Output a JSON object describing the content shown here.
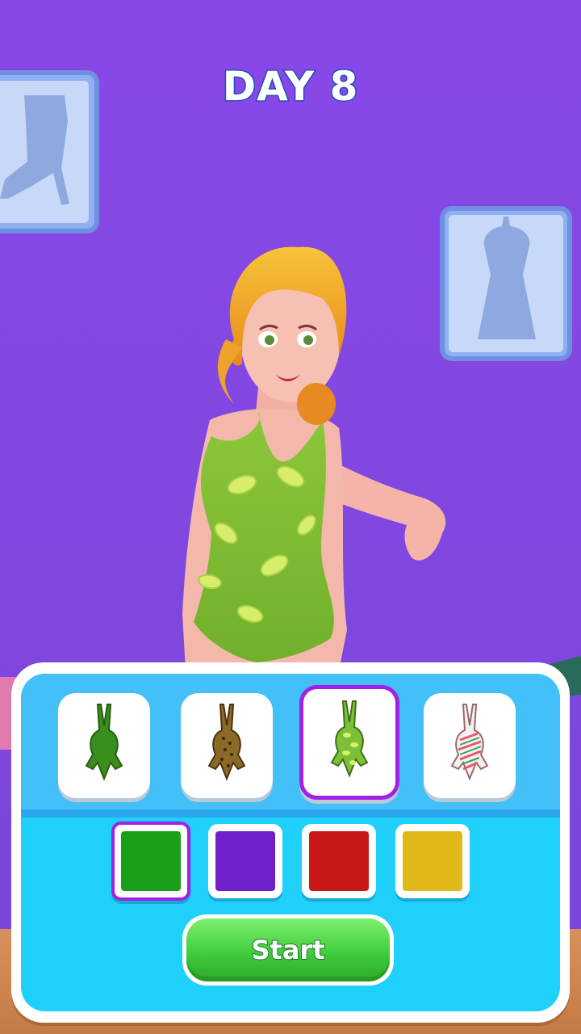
{
  "header": {
    "day_label": "DAY 8"
  },
  "outfits": [
    {
      "name": "green-solid-swimsuit",
      "color": "#3a8e1e",
      "selected": false
    },
    {
      "name": "leopard-print-swimsuit",
      "color": "#7a5a1c",
      "selected": false
    },
    {
      "name": "lime-print-swimsuit",
      "color": "#8fcf3c",
      "selected": true
    },
    {
      "name": "candy-stripe-swimsuit",
      "color": "#e85a6a",
      "selected": false
    }
  ],
  "colors": [
    {
      "name": "green",
      "hex": "#18a01a",
      "selected": true
    },
    {
      "name": "purple",
      "hex": "#7020c8",
      "selected": false
    },
    {
      "name": "red",
      "hex": "#c81818",
      "selected": false
    },
    {
      "name": "yellow",
      "hex": "#e0b818",
      "selected": false
    }
  ],
  "start_button": {
    "label": "Start"
  }
}
